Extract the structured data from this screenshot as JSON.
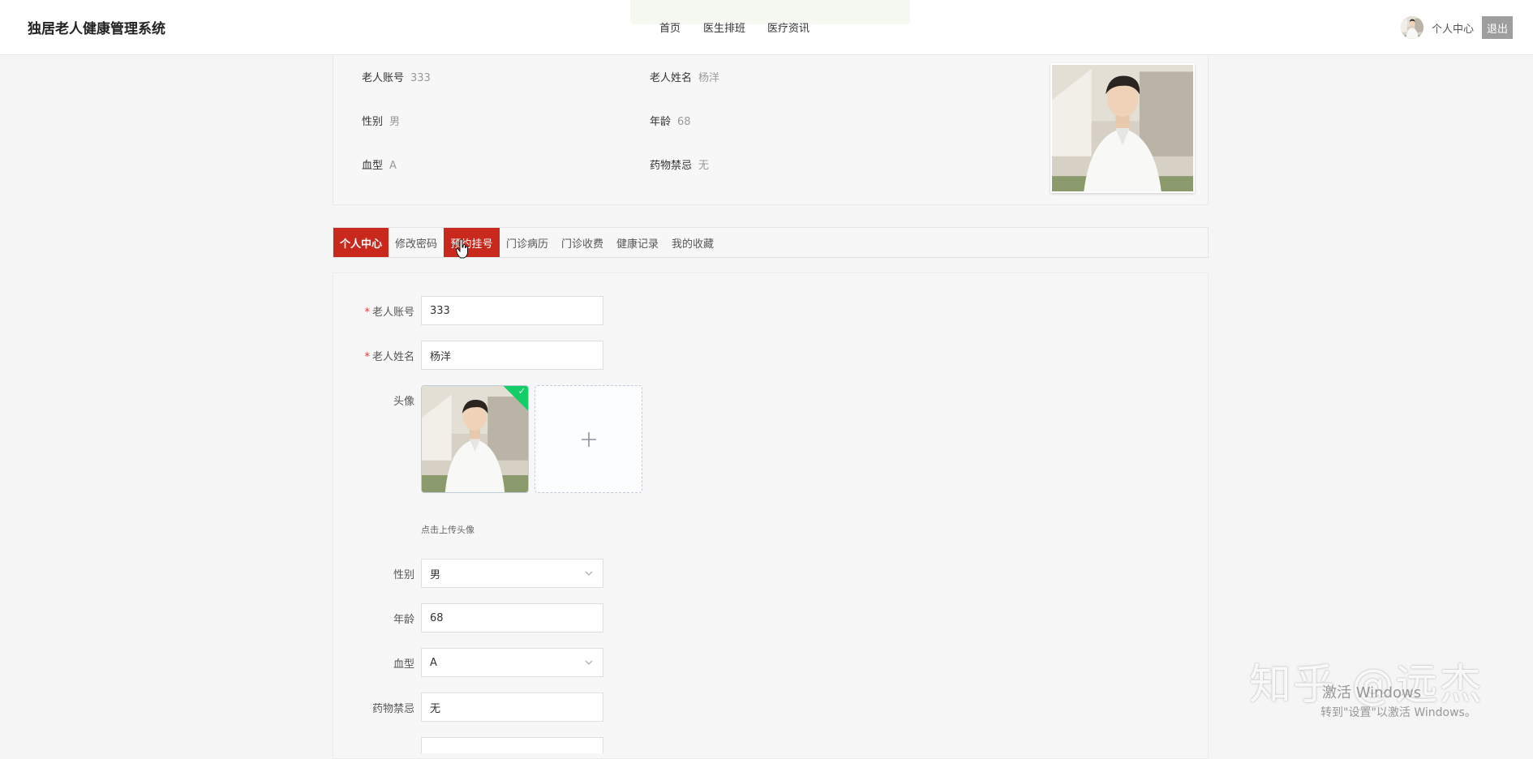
{
  "header": {
    "title": "独居老人健康管理系统",
    "nav": [
      {
        "label": "首页"
      },
      {
        "label": "医生排班"
      },
      {
        "label": "医疗资讯"
      }
    ],
    "user_center": "个人中心",
    "logout": "退出"
  },
  "profile": {
    "rows": [
      {
        "label": "老人账号",
        "value": "333"
      },
      {
        "label": "老人姓名",
        "value": "杨洋"
      },
      {
        "label": "性别",
        "value": "男"
      },
      {
        "label": "年龄",
        "value": "68"
      },
      {
        "label": "血型",
        "value": "A"
      },
      {
        "label": "药物禁忌",
        "value": "无"
      }
    ]
  },
  "tabs": [
    {
      "label": "个人中心",
      "state": "active"
    },
    {
      "label": "修改密码",
      "state": "normal"
    },
    {
      "label": "预约挂号",
      "state": "hover"
    },
    {
      "label": "门诊病历",
      "state": "normal"
    },
    {
      "label": "门诊收费",
      "state": "normal"
    },
    {
      "label": "健康记录",
      "state": "normal"
    },
    {
      "label": "我的收藏",
      "state": "normal"
    }
  ],
  "form": {
    "account": {
      "label": "老人账号",
      "required": "*",
      "value": "333"
    },
    "name": {
      "label": "老人姓名",
      "required": "*",
      "value": "杨洋"
    },
    "avatar": {
      "label": "头像",
      "tip": "点击上传头像"
    },
    "gender": {
      "label": "性别",
      "value": "男"
    },
    "age": {
      "label": "年龄",
      "value": "68"
    },
    "blood": {
      "label": "血型",
      "value": "A"
    },
    "drug": {
      "label": "药物禁忌",
      "value": "无"
    }
  },
  "watermark": {
    "zhihu": "知乎 @远杰",
    "activate": "激活 Windows",
    "activate_sub": "转到\"设置\"以激活 Windows。"
  },
  "colors": {
    "accent": "#c9291c",
    "upload_success": "#13ce66"
  },
  "icons": [
    "chevron-down-icon",
    "plus-icon",
    "check-icon",
    "hand-cursor-icon"
  ]
}
